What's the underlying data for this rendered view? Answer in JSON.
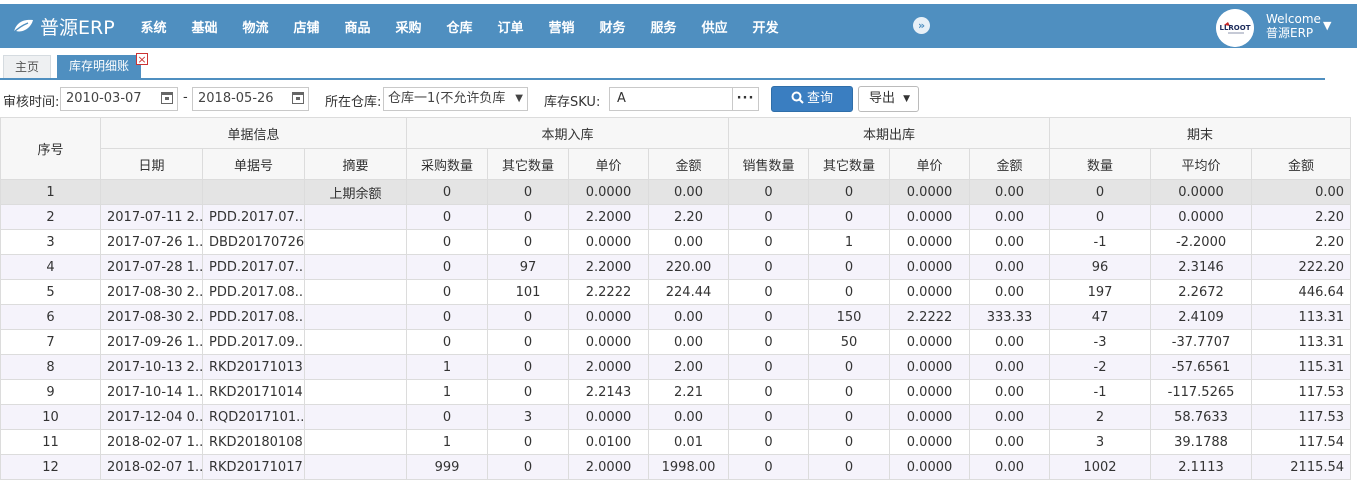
{
  "app": {
    "name": "普源ERP"
  },
  "nav": [
    "系统",
    "基础",
    "物流",
    "店铺",
    "商品",
    "采购",
    "仓库",
    "订单",
    "营销",
    "财务",
    "服务",
    "供应",
    "开发"
  ],
  "user": {
    "welcome": "Welcome",
    "name": "普源ERP",
    "avatar_text": "LLROOT"
  },
  "tabs": {
    "home": "主页",
    "active": "库存明细账",
    "close": "×"
  },
  "filters": {
    "audit_label": "审核时间:",
    "date_from": "2010-03-07",
    "date_to": "2018-05-26",
    "dash": "-",
    "warehouse_label": "所在仓库:",
    "warehouse_value": "仓库一1(不允许负库",
    "sku_label": "库存SKU:",
    "sku_value": "A",
    "sku_more": "···",
    "query_button": "查询",
    "export_button": "导出"
  },
  "table": {
    "groups": {
      "seq": "序号",
      "doc_info": "单据信息",
      "in": "本期入库",
      "out": "本期出库",
      "end": "期末"
    },
    "columns": [
      "日期",
      "单据号",
      "摘要",
      "采购数量",
      "其它数量",
      "单价",
      "金额",
      "销售数量",
      "其它数量",
      "单价",
      "金额",
      "数量",
      "平均价",
      "金额"
    ],
    "rows": [
      [
        "1",
        "",
        "",
        "上期余额",
        "0",
        "0",
        "0.0000",
        "0.00",
        "0",
        "0",
        "0.0000",
        "0.00",
        "0",
        "0.0000",
        "0.00"
      ],
      [
        "2",
        "2017-07-11 2...",
        "PDD.2017.07....",
        "",
        "0",
        "0",
        "2.2000",
        "2.20",
        "0",
        "0",
        "0.0000",
        "0.00",
        "0",
        "0.0000",
        "2.20"
      ],
      [
        "3",
        "2017-07-26 1...",
        "DBD20170726...",
        "",
        "0",
        "0",
        "0.0000",
        "0.00",
        "0",
        "1",
        "0.0000",
        "0.00",
        "-1",
        "-2.2000",
        "2.20"
      ],
      [
        "4",
        "2017-07-28 1...",
        "PDD.2017.07....",
        "",
        "0",
        "97",
        "2.2000",
        "220.00",
        "0",
        "0",
        "0.0000",
        "0.00",
        "96",
        "2.3146",
        "222.20"
      ],
      [
        "5",
        "2017-08-30 2...",
        "PDD.2017.08....",
        "",
        "0",
        "101",
        "2.2222",
        "224.44",
        "0",
        "0",
        "0.0000",
        "0.00",
        "197",
        "2.2672",
        "446.64"
      ],
      [
        "6",
        "2017-08-30 2...",
        "PDD.2017.08....",
        "",
        "0",
        "0",
        "0.0000",
        "0.00",
        "0",
        "150",
        "2.2222",
        "333.33",
        "47",
        "2.4109",
        "113.31"
      ],
      [
        "7",
        "2017-09-26 1...",
        "PDD.2017.09....",
        "",
        "0",
        "0",
        "0.0000",
        "0.00",
        "0",
        "50",
        "0.0000",
        "0.00",
        "-3",
        "-37.7707",
        "113.31"
      ],
      [
        "8",
        "2017-10-13 2...",
        "RKD20171013...",
        "",
        "1",
        "0",
        "2.0000",
        "2.00",
        "0",
        "0",
        "0.0000",
        "0.00",
        "-2",
        "-57.6561",
        "115.31"
      ],
      [
        "9",
        "2017-10-14 1...",
        "RKD20171014...",
        "",
        "1",
        "0",
        "2.2143",
        "2.21",
        "0",
        "0",
        "0.0000",
        "0.00",
        "-1",
        "-117.5265",
        "117.53"
      ],
      [
        "10",
        "2017-12-04 0...",
        "RQD2017101...",
        "",
        "0",
        "3",
        "0.0000",
        "0.00",
        "0",
        "0",
        "0.0000",
        "0.00",
        "2",
        "58.7633",
        "117.53"
      ],
      [
        "11",
        "2018-02-07 1...",
        "RKD20180108...",
        "",
        "1",
        "0",
        "0.0100",
        "0.01",
        "0",
        "0",
        "0.0000",
        "0.00",
        "3",
        "39.1788",
        "117.54"
      ],
      [
        "12",
        "2018-02-07 1...",
        "RKD20171017...",
        "",
        "999",
        "0",
        "2.0000",
        "1998.00",
        "0",
        "0",
        "0.0000",
        "0.00",
        "1002",
        "2.1113",
        "2115.54"
      ]
    ]
  },
  "colors": {
    "header_blue": "#4f8fc0",
    "button_blue": "#3a7ec1",
    "row_alt": "#f5f3fb",
    "row_selected": "#e4e4e4"
  },
  "icons": [
    "leaf-logo-icon",
    "chevrons-right-icon",
    "chevron-down-icon",
    "calendar-icon",
    "search-icon",
    "caret-down-icon",
    "close-icon"
  ]
}
